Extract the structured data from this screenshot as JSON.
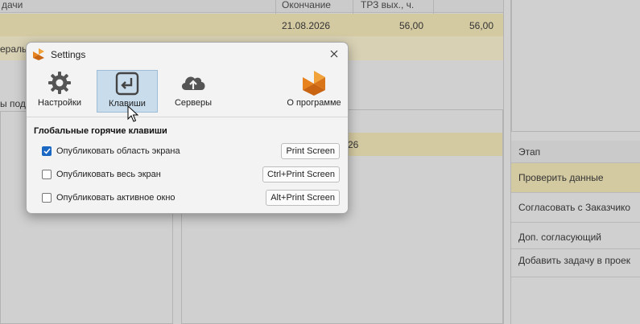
{
  "background": {
    "header": {
      "col_task": "дачи",
      "col_end": "Окончание",
      "col_hours": "ТРЗ вых., ч."
    },
    "row1": {
      "end_date": "21.08.2026",
      "hours": "56,00",
      "hours2": "56,00"
    },
    "row2": {
      "text": "ераль"
    },
    "left_label": "ы под",
    "middle_value": "26",
    "stage_panel": {
      "header": "Этап",
      "items": [
        "Проверить данные",
        "Согласовать с Заказчико",
        "Доп. согласующий",
        "Добавить задачу в проек"
      ]
    }
  },
  "dialog": {
    "title": "Settings",
    "toolbar": [
      {
        "label": "Настройки",
        "icon": "gear-icon"
      },
      {
        "label": "Клавиши",
        "icon": "enter-key-icon",
        "active": true
      },
      {
        "label": "Серверы",
        "icon": "cloud-upload-icon"
      },
      {
        "label": "О программе",
        "icon": "app-logo-icon"
      }
    ],
    "section_title": "Глобальные горячие клавиши",
    "options": [
      {
        "label": "Опубликовать область экрана",
        "checked": true,
        "hotkey": "Print Screen"
      },
      {
        "label": "Опубликовать весь экран",
        "checked": false,
        "hotkey": "Ctrl+Print Screen"
      },
      {
        "label": "Опубликовать активное окно",
        "checked": false,
        "hotkey": "Alt+Print Screen"
      }
    ]
  },
  "colors": {
    "accent": "#1a68c4",
    "active_tab": "#c9dcec",
    "logo_orange": "#e8821c"
  }
}
